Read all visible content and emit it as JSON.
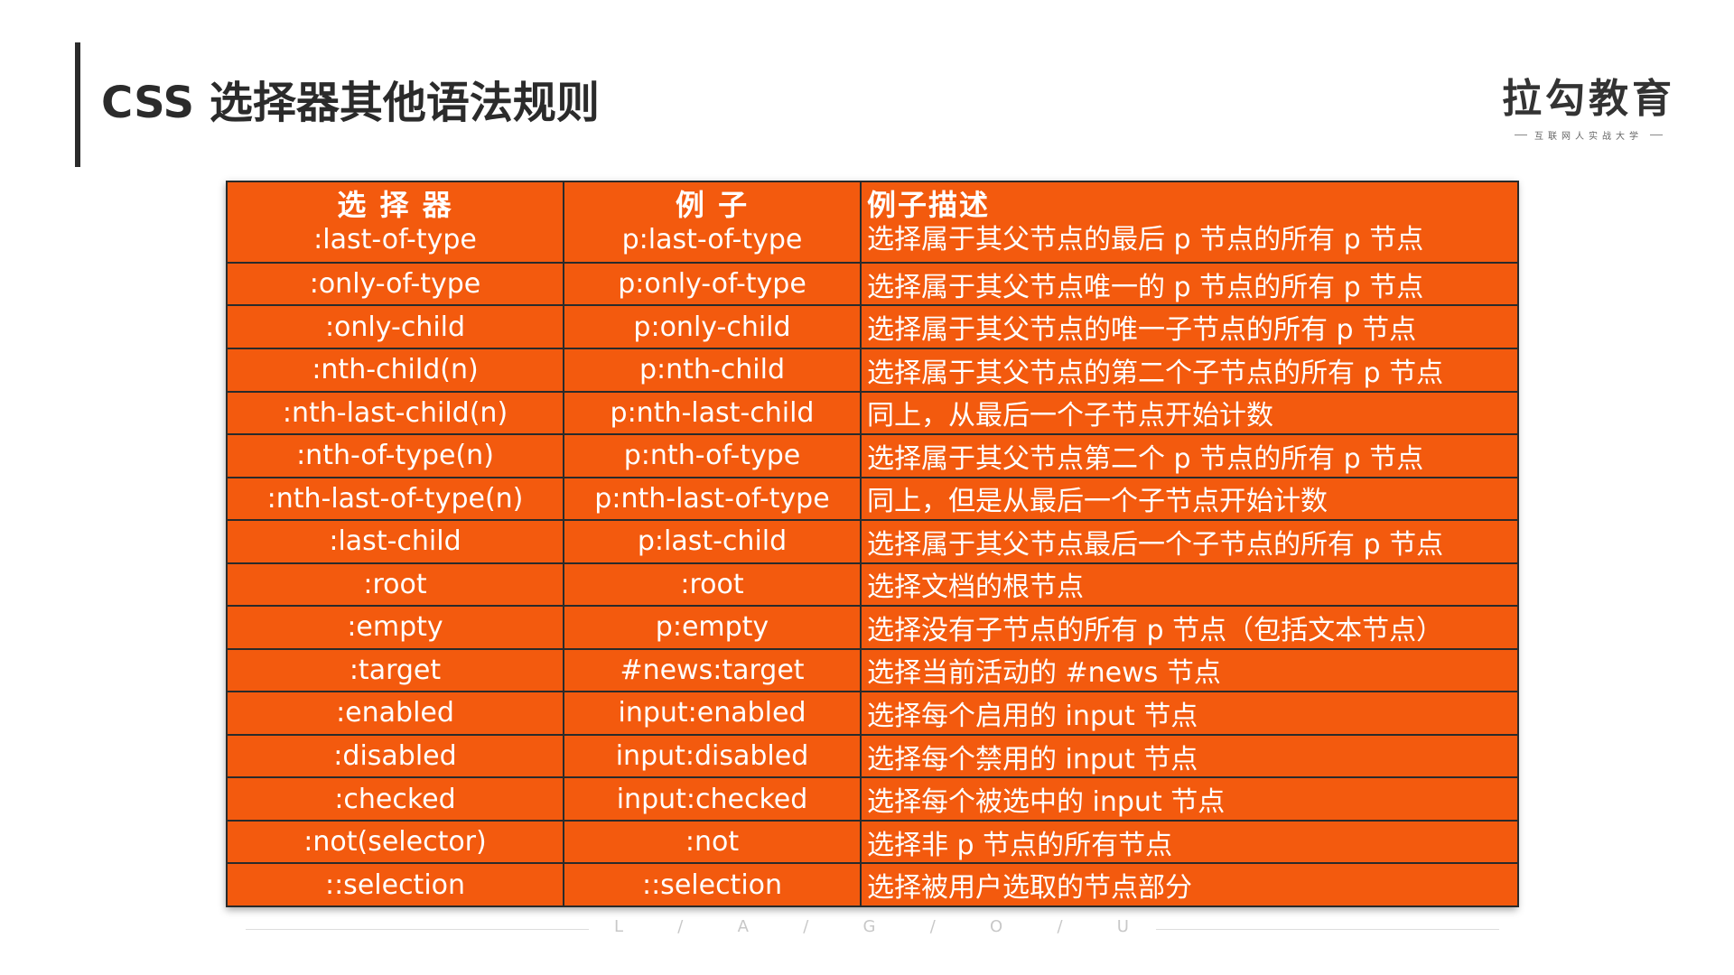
{
  "header": {
    "title": "CSS 选择器其他语法规则"
  },
  "brand": {
    "name": "拉勾教育",
    "tagline": "互联网人实战大学"
  },
  "table": {
    "headers": [
      "选 择 器",
      "例 子",
      "例子描述"
    ],
    "rows": [
      [
        ":last-of-type",
        "p:last-of-type",
        "选择属于其父节点的最后 p 节点的所有 p 节点"
      ],
      [
        ":only-of-type",
        "p:only-of-type",
        "选择属于其父节点唯一的 p 节点的所有 p 节点"
      ],
      [
        ":only-child",
        "p:only-child",
        "选择属于其父节点的唯一子节点的所有 p 节点"
      ],
      [
        ":nth-child(n)",
        "p:nth-child",
        "选择属于其父节点的第二个子节点的所有 p 节点"
      ],
      [
        ":nth-last-child(n)",
        "p:nth-last-child",
        "同上，从最后一个子节点开始计数"
      ],
      [
        ":nth-of-type(n)",
        "p:nth-of-type",
        "选择属于其父节点第二个 p 节点的所有 p 节点"
      ],
      [
        ":nth-last-of-type(n)",
        "p:nth-last-of-type",
        "同上，但是从最后一个子节点开始计数"
      ],
      [
        ":last-child",
        "p:last-child",
        "选择属于其父节点最后一个子节点的所有 p 节点"
      ],
      [
        ":root",
        ":root",
        "选择文档的根节点"
      ],
      [
        ":empty",
        "p:empty",
        "选择没有子节点的所有 p 节点（包括文本节点）"
      ],
      [
        ":target",
        "#news:target",
        "选择当前活动的 #news 节点"
      ],
      [
        ":enabled",
        "input:enabled",
        "选择每个启用的 input 节点"
      ],
      [
        ":disabled",
        "input:disabled",
        "选择每个禁用的 input 节点"
      ],
      [
        ":checked",
        "input:checked",
        "选择每个被选中的 input 节点"
      ],
      [
        ":not(selector)",
        ":not",
        "选择非 p 节点的所有节点"
      ],
      [
        "::selection",
        "::selection",
        "选择被用户选取的节点部分"
      ]
    ]
  },
  "footer": {
    "letters": [
      "L",
      "/",
      "A",
      "/",
      "G",
      "/",
      "O",
      "/",
      "U"
    ]
  },
  "colors": {
    "table_bg": "#f35a0e",
    "grid": "#2a2a2a",
    "title": "#2b2b2b"
  }
}
